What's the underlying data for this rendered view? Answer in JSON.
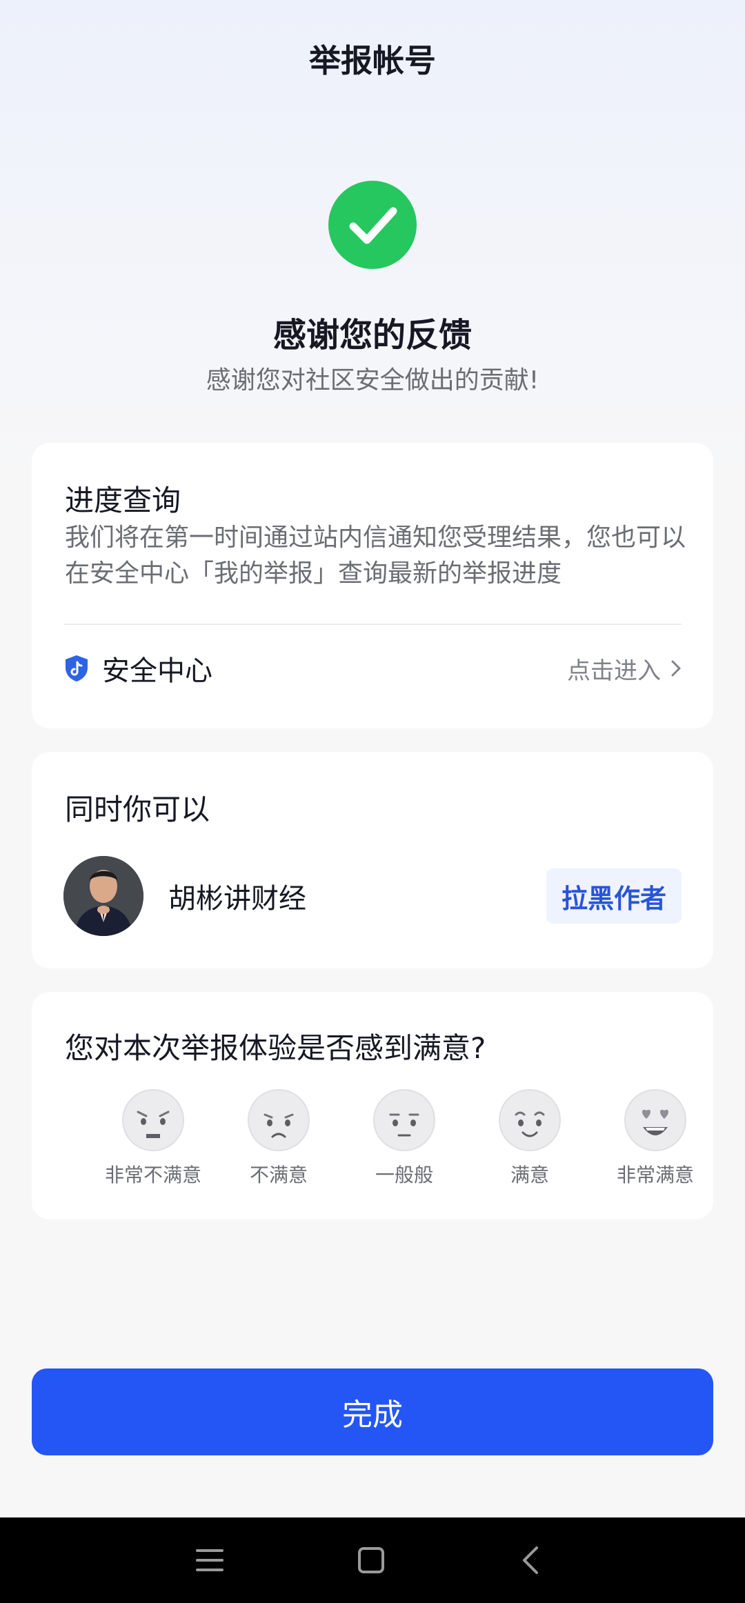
{
  "header": {
    "title": "举报帐号"
  },
  "status": {
    "title": "感谢您的反馈",
    "subtitle": "感谢您对社区安全做出的贡献!",
    "accent_color": "#26c75f"
  },
  "progress_card": {
    "title": "进度查询",
    "description": "我们将在第一时间通过站内信通知您受理结果，您也可以在安全中心「我的举报」查询最新的举报进度",
    "security_center": {
      "label": "安全中心",
      "action": "点击进入",
      "icon": "shield-icon"
    }
  },
  "also_card": {
    "title": "同时你可以",
    "author": {
      "name": "胡彬讲财经"
    },
    "block_button": "拉黑作者"
  },
  "survey_card": {
    "question": "您对本次举报体验是否感到满意?",
    "options": [
      {
        "label": "非常不满意",
        "icon": "very-unsatisfied-face-icon"
      },
      {
        "label": "不满意",
        "icon": "unsatisfied-face-icon"
      },
      {
        "label": "一般般",
        "icon": "neutral-face-icon"
      },
      {
        "label": "满意",
        "icon": "satisfied-face-icon"
      },
      {
        "label": "非常满意",
        "icon": "very-satisfied-face-icon"
      }
    ]
  },
  "footer": {
    "done_button": "完成",
    "button_color": "#2456f6"
  },
  "navbar": {
    "icons": [
      "menu-icon",
      "home-icon",
      "back-icon"
    ]
  }
}
